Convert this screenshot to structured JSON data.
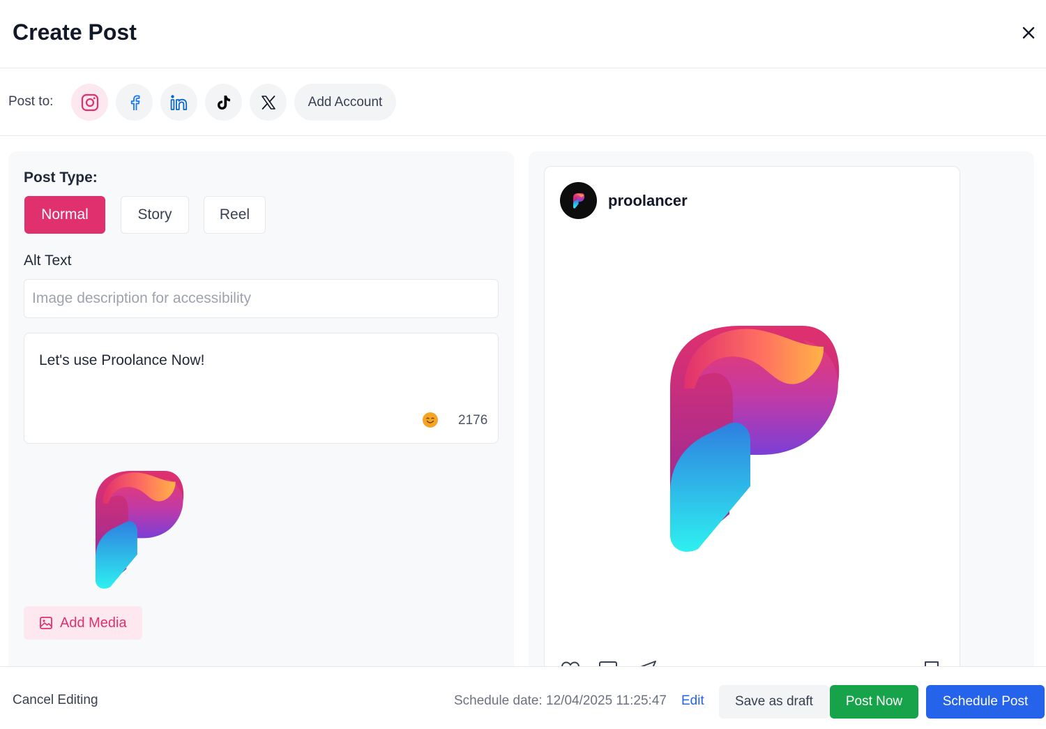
{
  "header": {
    "title": "Create Post"
  },
  "post_to": {
    "label": "Post to:",
    "accounts": [
      {
        "name": "instagram",
        "icon": "instagram-icon",
        "selected": true,
        "color": "#e0306e"
      },
      {
        "name": "facebook",
        "icon": "facebook-icon",
        "selected": false,
        "color": "#1877f2"
      },
      {
        "name": "linkedin",
        "icon": "linkedin-icon",
        "selected": false,
        "color": "#0a66c2"
      },
      {
        "name": "tiktok",
        "icon": "tiktok-icon",
        "selected": false,
        "color": "#000000"
      },
      {
        "name": "x",
        "icon": "x-icon",
        "selected": false,
        "color": "#111827"
      }
    ],
    "add_account_label": "Add Account"
  },
  "editor": {
    "post_type_label": "Post Type:",
    "post_types": [
      "Normal",
      "Story",
      "Reel"
    ],
    "selected_post_type": "Normal",
    "alt_text_label": "Alt Text",
    "alt_text_placeholder": "Image description for accessibility",
    "alt_text_value": "",
    "caption": "Let's use Proolance Now!",
    "char_count": "2176",
    "add_media_label": "Add Media"
  },
  "preview": {
    "username": "proolancer"
  },
  "footer": {
    "cancel_label": "Cancel Editing",
    "schedule_text": "Schedule date: 12/04/2025 11:25:47",
    "edit_label": "Edit",
    "save_draft_label": "Save as draft",
    "post_now_label": "Post Now",
    "schedule_label": "Schedule Post"
  },
  "colors": {
    "accent_pink": "#e0306e",
    "post_now_green": "#16a34a",
    "schedule_blue": "#2563eb"
  }
}
